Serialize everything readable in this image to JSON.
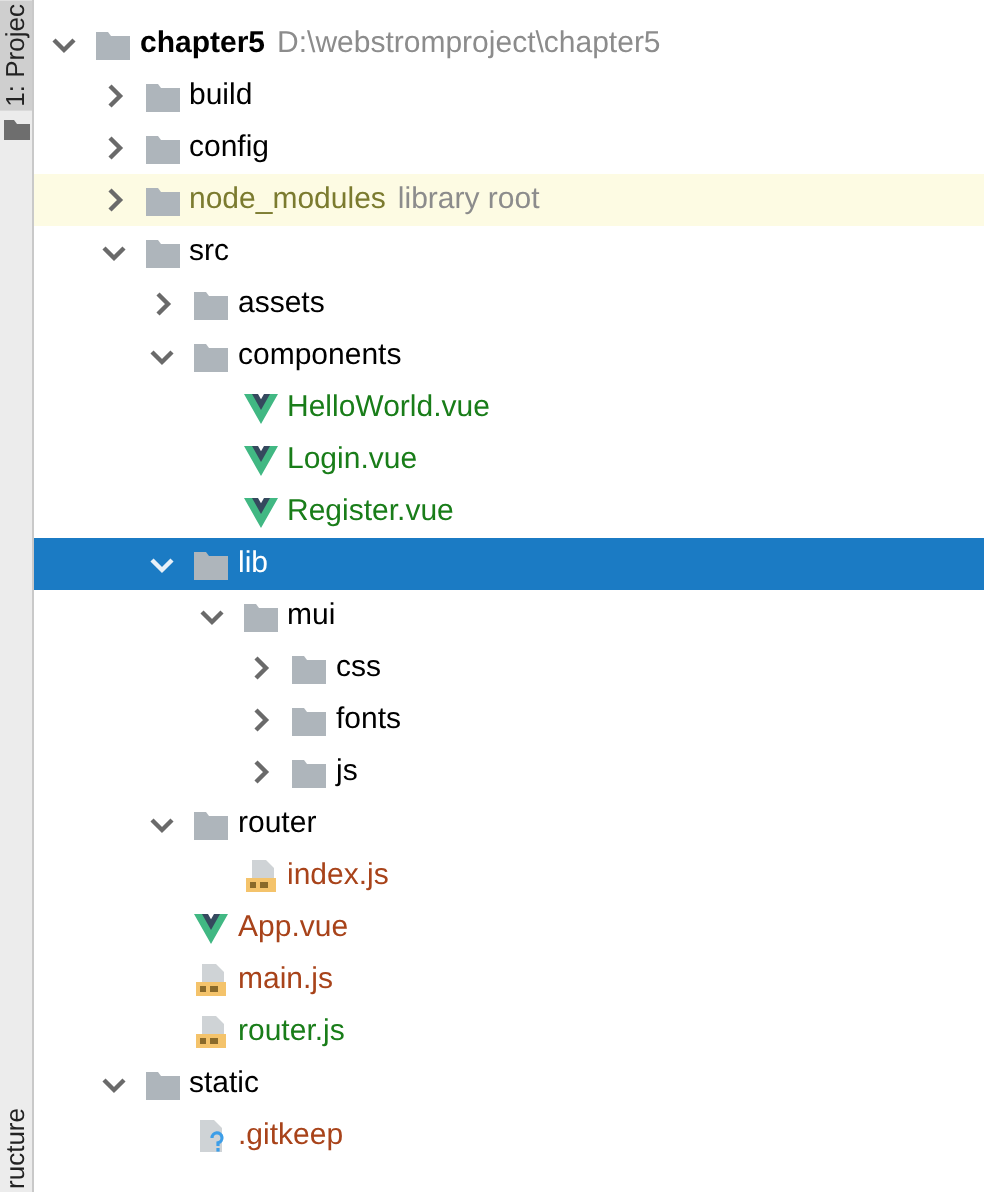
{
  "side_tabs": [
    {
      "label": "1: Projec",
      "selected": true
    },
    {
      "label": "ructure",
      "selected": false
    }
  ],
  "tree": [
    {
      "name": "chapter5",
      "kind": "project",
      "expanded": true,
      "selected": false,
      "hint": "D:\\webstromproject\\chapter5",
      "children": [
        {
          "name": "build",
          "kind": "folder",
          "expanded": false,
          "selected": false
        },
        {
          "name": "config",
          "kind": "folder",
          "expanded": false,
          "selected": false
        },
        {
          "name": "node_modules",
          "kind": "folder",
          "expanded": false,
          "selected": false,
          "highlighted": true,
          "color": "#7b7b2f",
          "hint": "library root"
        },
        {
          "name": "src",
          "kind": "folder",
          "expanded": true,
          "selected": false,
          "children": [
            {
              "name": "assets",
              "kind": "folder",
              "expanded": false,
              "selected": false
            },
            {
              "name": "components",
              "kind": "folder",
              "expanded": true,
              "selected": false,
              "children": [
                {
                  "name": "HelloWorld.vue",
                  "kind": "vue",
                  "selected": false,
                  "color": "#197d19"
                },
                {
                  "name": "Login.vue",
                  "kind": "vue",
                  "selected": false,
                  "color": "#197d19"
                },
                {
                  "name": "Register.vue",
                  "kind": "vue",
                  "selected": false,
                  "color": "#197d19"
                }
              ]
            },
            {
              "name": "lib",
              "kind": "folder",
              "expanded": true,
              "selected": true,
              "children": [
                {
                  "name": "mui",
                  "kind": "folder",
                  "expanded": true,
                  "selected": false,
                  "children": [
                    {
                      "name": "css",
                      "kind": "folder",
                      "expanded": false,
                      "selected": false
                    },
                    {
                      "name": "fonts",
                      "kind": "folder",
                      "expanded": false,
                      "selected": false
                    },
                    {
                      "name": "js",
                      "kind": "folder",
                      "expanded": false,
                      "selected": false
                    }
                  ]
                }
              ]
            },
            {
              "name": "router",
              "kind": "folder",
              "expanded": true,
              "selected": false,
              "children": [
                {
                  "name": "index.js",
                  "kind": "js",
                  "selected": false,
                  "color": "#a8431a"
                }
              ]
            },
            {
              "name": "App.vue",
              "kind": "vue",
              "selected": false,
              "color": "#a8431a"
            },
            {
              "name": "main.js",
              "kind": "js",
              "selected": false,
              "color": "#a8431a"
            },
            {
              "name": "router.js",
              "kind": "js",
              "selected": false,
              "color": "#197d19"
            }
          ]
        },
        {
          "name": "static",
          "kind": "folder",
          "expanded": true,
          "selected": false,
          "children": [
            {
              "name": ".gitkeep",
              "kind": "unknown",
              "selected": false,
              "color": "#a8431a"
            }
          ]
        }
      ]
    }
  ]
}
